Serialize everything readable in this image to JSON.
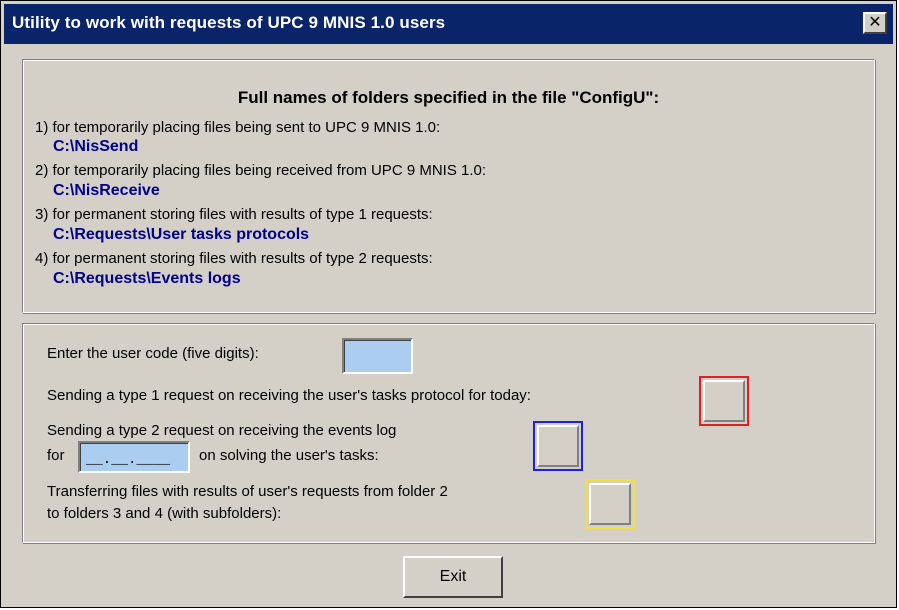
{
  "window": {
    "title": "Utility to work with requests of UPC 9 MNIS 1.0 users",
    "close_label": "✕"
  },
  "folders": {
    "heading": "Full names of folders specified in the file \"ConfigU\":",
    "items": [
      {
        "label": "1) for temporarily placing files being sent to UPC 9 MNIS 1.0:",
        "path": "C:\\NisSend"
      },
      {
        "label": "2) for temporarily placing files being received from UPC 9 MNIS 1.0:",
        "path": "C:\\NisReceive"
      },
      {
        "label": "3) for permanent storing files with results of type 1 requests:",
        "path": "C:\\Requests\\User tasks protocols"
      },
      {
        "label": "4) for permanent storing files with results of type 2 requests:",
        "path": "C:\\Requests\\Events logs"
      }
    ],
    "path_color": "#00008b"
  },
  "actions": {
    "user_code": {
      "label": "Enter the user code (five digits):",
      "value": ""
    },
    "type1": {
      "label": "Sending a type 1 request on receiving the user's tasks protocol for today:",
      "button_color": "#e02020"
    },
    "type2": {
      "label_line1": "Sending a type 2 request on receiving the events log",
      "label_for": "for",
      "date_value": "__.__.____",
      "label_line2": "on solving the user's tasks:",
      "button_color": "#2020e0"
    },
    "transfer": {
      "label_line1": "Transferring files with results of user's requests from folder 2",
      "label_line2": "to folders 3 and 4 (with subfolders):",
      "button_color": "#f0e040"
    }
  },
  "footer": {
    "exit_label": "Exit"
  }
}
